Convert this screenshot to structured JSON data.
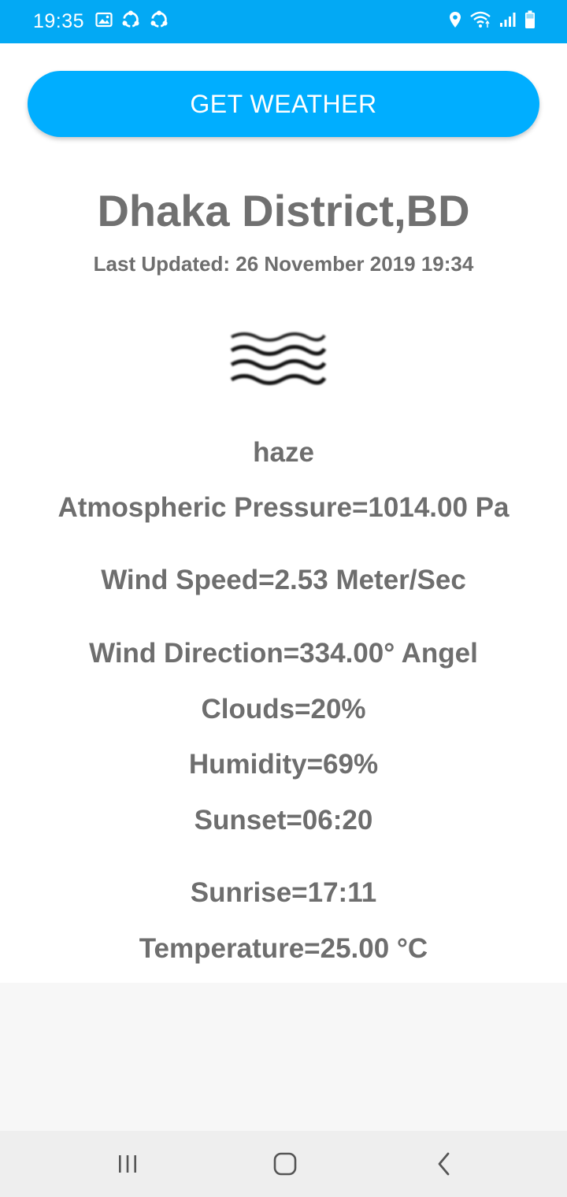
{
  "status_bar": {
    "time": "19:35",
    "left_icons": [
      "image-icon",
      "sync-icon",
      "sync-icon"
    ],
    "right_icons": [
      "location-icon",
      "wifi-icon",
      "signal-icon",
      "battery-icon"
    ],
    "color": "#03A9F4"
  },
  "main": {
    "button_label": "GET WEATHER",
    "city": "Dhaka District,BD",
    "last_updated": "Last Updated: 26 November 2019 19:34",
    "weather_icon": "haze-icon",
    "description": "haze",
    "pressure": "Atmospheric Pressure=1014.00 Pa",
    "wind_speed": "Wind Speed=2.53 Meter/Sec",
    "wind_direction": "Wind Direction=334.00° Angel",
    "clouds": "Clouds=20%",
    "humidity": "Humidity=69%",
    "sunset": "Sunset=06:20",
    "sunrise": "Sunrise=17:11",
    "temperature": "Temperature=25.00 °C",
    "accent_color": "#00AEFF"
  },
  "nav_bar": {
    "buttons": [
      "recent-apps-icon",
      "home-icon",
      "back-icon"
    ]
  }
}
